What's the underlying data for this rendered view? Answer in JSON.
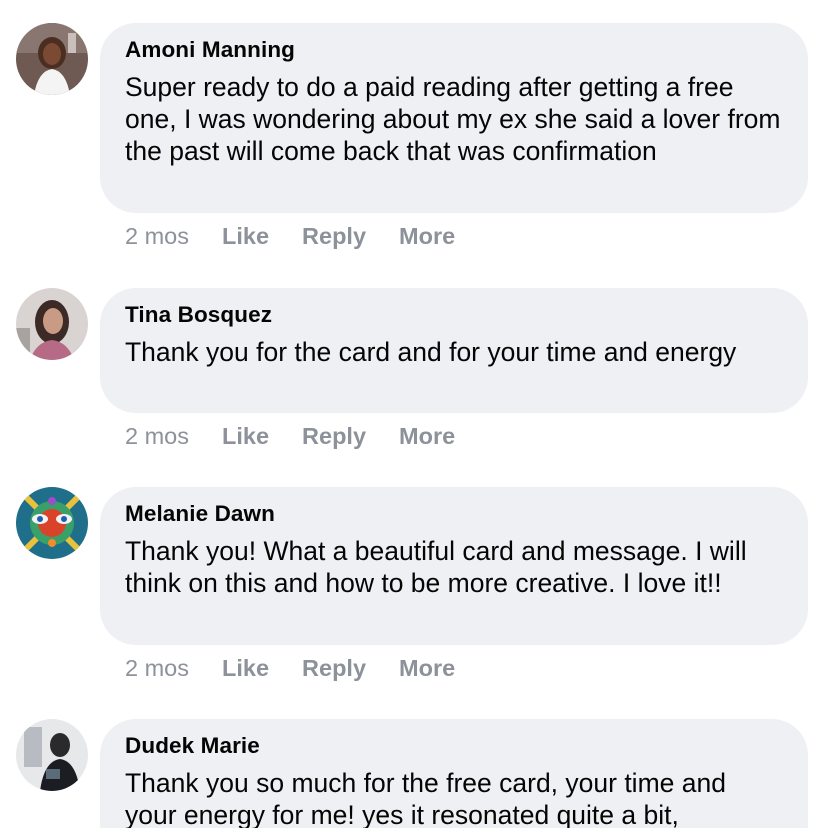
{
  "comments": [
    {
      "author": "Amoni Manning",
      "text": "Super ready to do a paid reading after getting a free one, I was wondering about my ex she said a lover from the past will come back that was confirmation",
      "time": "2 mos",
      "like": "Like",
      "reply": "Reply",
      "more": "More"
    },
    {
      "author": "Tina Bosquez",
      "text": "Thank you for the card and for your time and energy",
      "time": "2 mos",
      "like": "Like",
      "reply": "Reply",
      "more": "More"
    },
    {
      "author": "Melanie Dawn",
      "text": "Thank you! What a beautiful card and message. I will think on this and how to be more creative. I love it!!",
      "time": "2 mos",
      "like": "Like",
      "reply": "Reply",
      "more": "More"
    },
    {
      "author": "Dudek Marie",
      "text": "Thank you so much for the free card, your time and your energy for me! yes it resonated quite a bit,",
      "time": "",
      "like": "",
      "reply": "",
      "more": ""
    }
  ],
  "colors": {
    "bubble": "#eff0f3",
    "meta": "#8d929a",
    "text": "#050505"
  }
}
